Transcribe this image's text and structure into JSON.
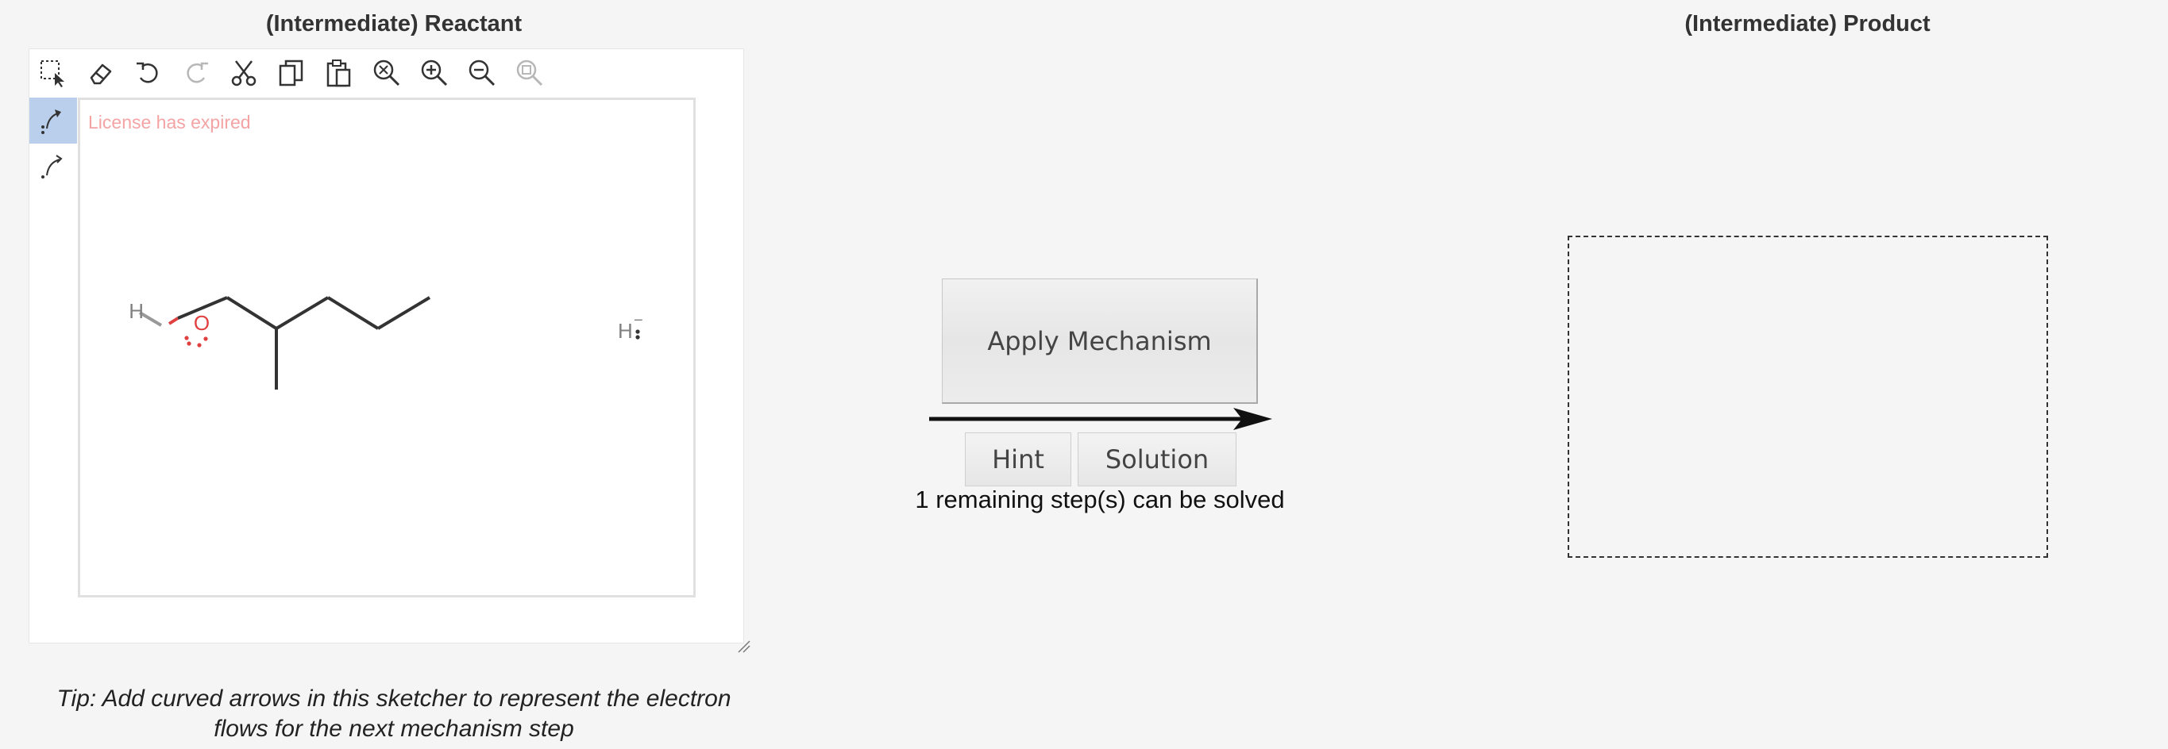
{
  "reactant_panel": {
    "title": "(Intermediate) Reactant",
    "toolbar": [
      {
        "icon": "selection-icon",
        "label": "Select"
      },
      {
        "icon": "eraser-icon",
        "label": "Erase"
      },
      {
        "icon": "undo-icon",
        "label": "Undo"
      },
      {
        "icon": "redo-icon",
        "label": "Redo"
      },
      {
        "icon": "cut-icon",
        "label": "Cut"
      },
      {
        "icon": "copy-icon",
        "label": "Copy"
      },
      {
        "icon": "paste-icon",
        "label": "Paste"
      },
      {
        "icon": "zoom-reset-icon",
        "label": "Reset zoom"
      },
      {
        "icon": "zoom-in-icon",
        "label": "Zoom in"
      },
      {
        "icon": "zoom-out-icon",
        "label": "Zoom out"
      },
      {
        "icon": "zoom-fit-icon",
        "label": "Fit"
      }
    ],
    "side_tools": [
      {
        "icon": "curved-arrow-pair-icon",
        "active": true
      },
      {
        "icon": "curved-arrow-single-icon",
        "active": false
      }
    ],
    "license_notice": "License has expired",
    "molecule": {
      "atom_h": "H",
      "atom_o": "O",
      "hydride": "H",
      "hydride_charge": "−",
      "colors": {
        "bond": "#333333",
        "oxygen": "#e04040",
        "hydrogen": "#808080"
      }
    },
    "tip": "Tip: Add curved arrows in this sketcher to represent the electron flows for the next mechanism step"
  },
  "controls": {
    "apply_label": "Apply Mechanism",
    "hint_label": "Hint",
    "solution_label": "Solution",
    "remaining_text": "1 remaining step(s) can be solved"
  },
  "product_panel": {
    "title": "(Intermediate) Product"
  },
  "colors": {
    "background": "#f5f5f5",
    "active_tool": "#b9cfec",
    "license_text": "#f4a4a4"
  }
}
